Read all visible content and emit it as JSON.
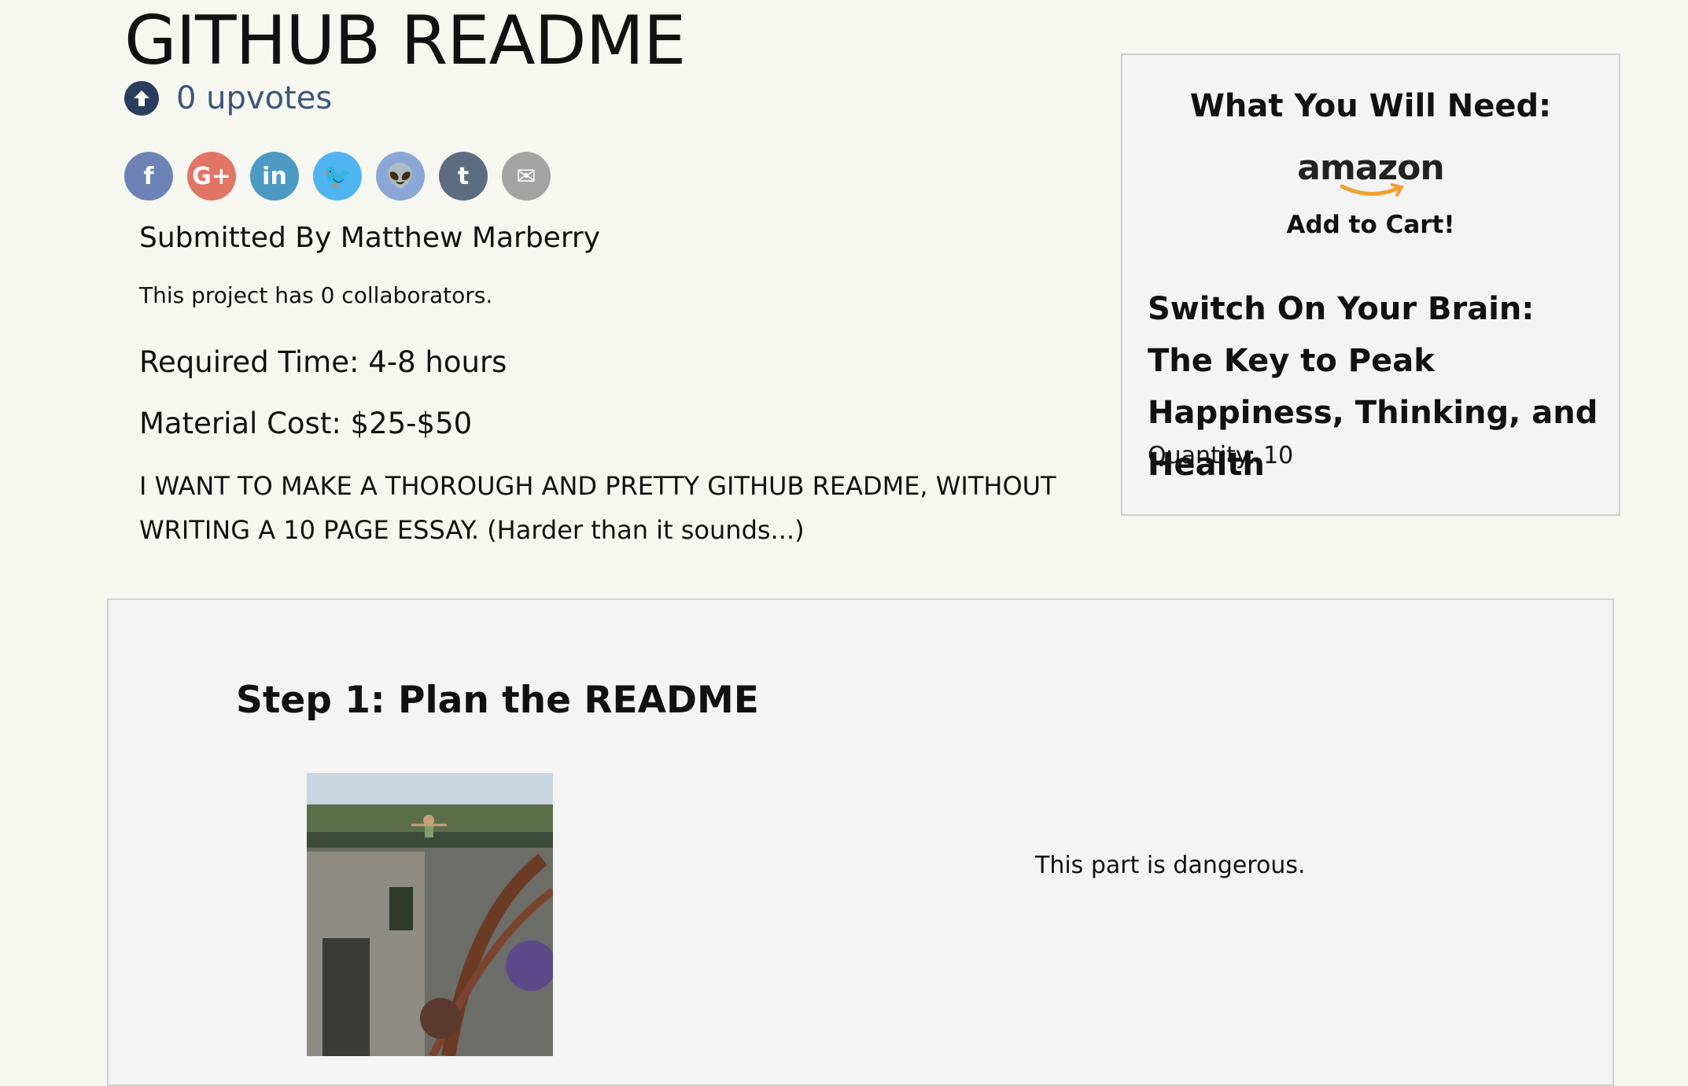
{
  "page": {
    "title": "GITHUB README",
    "upvotes": "0 upvotes",
    "social_icons": [
      "facebook-icon",
      "google-plus-icon",
      "linkedin-icon",
      "twitter-icon",
      "reddit-icon",
      "tumblr-icon",
      "email-icon"
    ],
    "social_glyphs": [
      "f",
      "G+",
      "in",
      "🐦",
      "👽",
      "t",
      "✉"
    ],
    "social_colors": [
      "#6d83b5",
      "#e17566",
      "#4c9ac4",
      "#4fb4ef",
      "#8ba7d6",
      "#5d6c81",
      "#a3a3a3"
    ],
    "submitted_by": "Submitted By Matthew Marberry",
    "collaborators": "This project has 0 collaborators.",
    "required_time": "Required Time: 4-8 hours",
    "material_cost": "Material Cost: $25-$50",
    "description": "I WANT TO MAKE A THOROUGH AND PRETTY GITHUB README, WITHOUT WRITING A 10 PAGE ESSAY. (Harder than it sounds...)"
  },
  "needs": {
    "heading": "What You Will Need:",
    "brand": "amazon",
    "add_to_cart": "Add to Cart!",
    "item_title": "Switch On Your Brain: The Key to Peak Happiness, Thinking, and Health",
    "quantity": "Quantity: 10"
  },
  "step": {
    "title": "Step 1: Plan the README",
    "note": "This part is dangerous."
  },
  "colors": {
    "background": "#f7f7f1",
    "panel": "#f4f4f4",
    "upvote_icon": "#2a3d5b",
    "upvote_text": "#3d5578",
    "amazon_smile": "#f0a030"
  }
}
